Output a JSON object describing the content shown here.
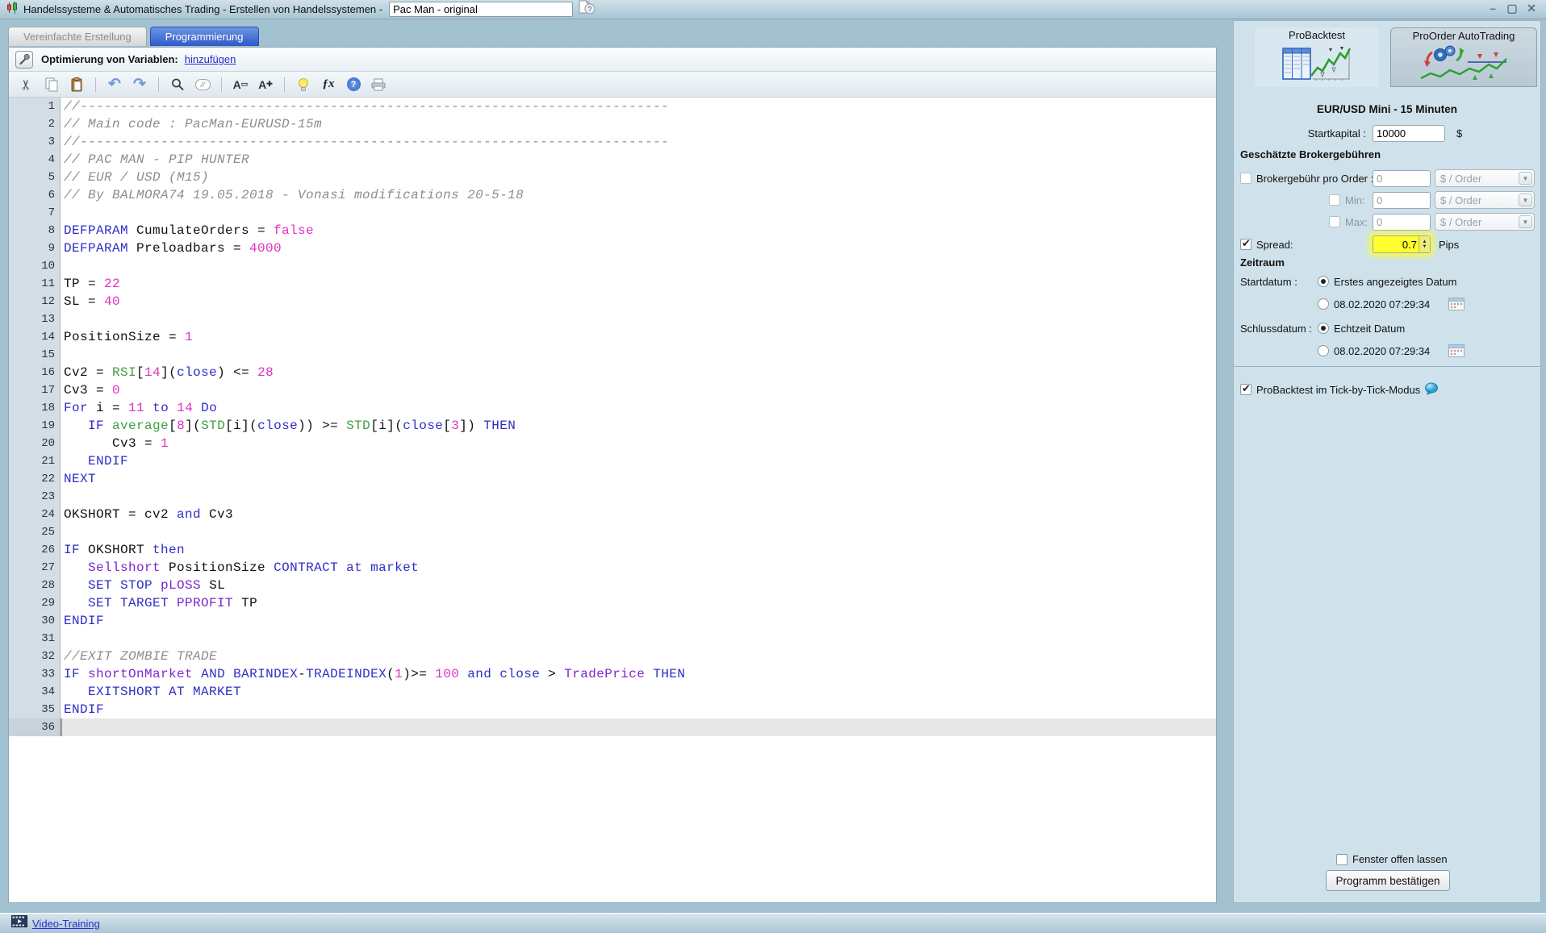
{
  "window": {
    "title": "Handelssysteme & Automatisches Trading - Erstellen von Handelssystemen  -",
    "name_value": "Pac Man - original",
    "controls": {
      "minimize": "–",
      "maximize": "▢",
      "close": "✕"
    }
  },
  "tabs": [
    {
      "label": "Vereinfachte Erstellung",
      "active": false
    },
    {
      "label": "Programmierung",
      "active": true
    }
  ],
  "optimization": {
    "label": "Optimierung von Variablen:",
    "link": "hinzufügen"
  },
  "toolbar": {
    "icons": [
      "cut",
      "copy",
      "paste",
      "undo",
      "redo",
      "search",
      "comment-toggle",
      "font-decrease",
      "font-increase",
      "hint",
      "insert-function",
      "help",
      "print"
    ]
  },
  "editor": {
    "current_line": 36,
    "lines": [
      {
        "tokens": [
          [
            "c",
            "//-------------------------------------------------------------------------"
          ]
        ]
      },
      {
        "tokens": [
          [
            "c",
            "// Main code : PacMan-EURUSD-15m"
          ]
        ]
      },
      {
        "tokens": [
          [
            "c",
            "//-------------------------------------------------------------------------"
          ]
        ]
      },
      {
        "tokens": [
          [
            "c",
            "// PAC MAN - PIP HUNTER"
          ]
        ]
      },
      {
        "tokens": [
          [
            "c",
            "// EUR / USD (M15)"
          ]
        ]
      },
      {
        "tokens": [
          [
            "c",
            "// By BALMORA74 19.05.2018 - Vonasi modifications 20-5-18"
          ]
        ]
      },
      {
        "tokens": []
      },
      {
        "tokens": [
          [
            "kw",
            "DEFPARAM"
          ],
          [
            "t",
            " CumulateOrders = "
          ],
          [
            "num",
            "false"
          ]
        ]
      },
      {
        "tokens": [
          [
            "kw",
            "DEFPARAM"
          ],
          [
            "t",
            " Preloadbars = "
          ],
          [
            "num",
            "4000"
          ]
        ]
      },
      {
        "tokens": []
      },
      {
        "tokens": [
          [
            "t",
            "TP = "
          ],
          [
            "num",
            "22"
          ]
        ]
      },
      {
        "tokens": [
          [
            "t",
            "SL = "
          ],
          [
            "num",
            "40"
          ]
        ]
      },
      {
        "tokens": []
      },
      {
        "tokens": [
          [
            "t",
            "PositionSize = "
          ],
          [
            "num",
            "1"
          ]
        ]
      },
      {
        "tokens": []
      },
      {
        "tokens": [
          [
            "t",
            "Cv2 = "
          ],
          [
            "fn",
            "RSI"
          ],
          [
            "t",
            "["
          ],
          [
            "num",
            "14"
          ],
          [
            "t",
            "]("
          ],
          [
            "kw",
            "close"
          ],
          [
            "t",
            ") <= "
          ],
          [
            "num",
            "28"
          ]
        ]
      },
      {
        "tokens": [
          [
            "t",
            "Cv3 = "
          ],
          [
            "num",
            "0"
          ]
        ]
      },
      {
        "tokens": [
          [
            "kw",
            "For"
          ],
          [
            "t",
            " i = "
          ],
          [
            "num",
            "11"
          ],
          [
            "t",
            " "
          ],
          [
            "kw",
            "to"
          ],
          [
            "t",
            " "
          ],
          [
            "num",
            "14"
          ],
          [
            "t",
            " "
          ],
          [
            "kw",
            "Do"
          ]
        ]
      },
      {
        "tokens": [
          [
            "t",
            "   "
          ],
          [
            "kw",
            "IF"
          ],
          [
            "t",
            " "
          ],
          [
            "fn",
            "average"
          ],
          [
            "t",
            "["
          ],
          [
            "num",
            "8"
          ],
          [
            "t",
            "]("
          ],
          [
            "fn",
            "STD"
          ],
          [
            "t",
            "[i]("
          ],
          [
            "kw",
            "close"
          ],
          [
            "t",
            ")) >= "
          ],
          [
            "fn",
            "STD"
          ],
          [
            "t",
            "[i]("
          ],
          [
            "kw",
            "close"
          ],
          [
            "t",
            "["
          ],
          [
            "num",
            "3"
          ],
          [
            "t",
            "]) "
          ],
          [
            "kw",
            "THEN"
          ]
        ]
      },
      {
        "tokens": [
          [
            "t",
            "      Cv3 = "
          ],
          [
            "num",
            "1"
          ]
        ]
      },
      {
        "tokens": [
          [
            "t",
            "   "
          ],
          [
            "kw",
            "ENDIF"
          ]
        ]
      },
      {
        "tokens": [
          [
            "kw",
            "NEXT"
          ]
        ]
      },
      {
        "tokens": []
      },
      {
        "tokens": [
          [
            "t",
            "OKSHORT = cv2 "
          ],
          [
            "kw",
            "and"
          ],
          [
            "t",
            " Cv3"
          ]
        ]
      },
      {
        "tokens": []
      },
      {
        "tokens": [
          [
            "kw",
            "IF"
          ],
          [
            "t",
            " OKSHORT "
          ],
          [
            "kw",
            "then"
          ]
        ]
      },
      {
        "tokens": [
          [
            "t",
            "   "
          ],
          [
            "pk",
            "Sellshort"
          ],
          [
            "t",
            " PositionSize "
          ],
          [
            "kw",
            "CONTRACT"
          ],
          [
            "t",
            " "
          ],
          [
            "kw",
            "at"
          ],
          [
            "t",
            " "
          ],
          [
            "kw",
            "market"
          ]
        ]
      },
      {
        "tokens": [
          [
            "t",
            "   "
          ],
          [
            "kw",
            "SET STOP"
          ],
          [
            "t",
            " "
          ],
          [
            "pk",
            "pLOSS"
          ],
          [
            "t",
            " SL"
          ]
        ]
      },
      {
        "tokens": [
          [
            "t",
            "   "
          ],
          [
            "kw",
            "SET TARGET"
          ],
          [
            "t",
            " "
          ],
          [
            "pk",
            "PPROFIT"
          ],
          [
            "t",
            " TP"
          ]
        ]
      },
      {
        "tokens": [
          [
            "kw",
            "ENDIF"
          ]
        ]
      },
      {
        "tokens": []
      },
      {
        "tokens": [
          [
            "c",
            "//EXIT ZOMBIE TRADE"
          ]
        ]
      },
      {
        "tokens": [
          [
            "kw",
            "IF"
          ],
          [
            "t",
            " "
          ],
          [
            "pk",
            "shortOnMarket"
          ],
          [
            "t",
            " "
          ],
          [
            "kw",
            "AND"
          ],
          [
            "t",
            " "
          ],
          [
            "kw",
            "BARINDEX"
          ],
          [
            "t",
            "-"
          ],
          [
            "kw",
            "TRADEINDEX"
          ],
          [
            "t",
            "("
          ],
          [
            "num",
            "1"
          ],
          [
            "t",
            ")>= "
          ],
          [
            "num",
            "100"
          ],
          [
            "t",
            " "
          ],
          [
            "kw",
            "and"
          ],
          [
            "t",
            " "
          ],
          [
            "kw",
            "close"
          ],
          [
            "t",
            " > "
          ],
          [
            "pk",
            "TradePrice"
          ],
          [
            "t",
            " "
          ],
          [
            "kw",
            "THEN"
          ]
        ]
      },
      {
        "tokens": [
          [
            "t",
            "   "
          ],
          [
            "kw",
            "EXITSHORT AT MARKET"
          ]
        ]
      },
      {
        "tokens": [
          [
            "kw",
            "ENDIF"
          ]
        ]
      },
      {
        "tokens": [],
        "current": true
      }
    ]
  },
  "sidebar": {
    "tabs": [
      {
        "label": "ProBacktest",
        "active": true
      },
      {
        "label": "ProOrder AutoTrading",
        "active": false
      }
    ],
    "instrument": "EUR/USD Mini - 15 Minuten",
    "startkapital": {
      "label": "Startkapital :",
      "value": "10000",
      "currency": "$"
    },
    "fees": {
      "heading": "Geschätzte Brokergebühren",
      "rows": [
        {
          "label": "Brokergebühr pro Order :",
          "checked": false,
          "value": "0",
          "unit": "$ / Order"
        },
        {
          "label": "Min:",
          "checked": false,
          "value": "0",
          "unit": "$ / Order"
        },
        {
          "label": "Max:",
          "checked": false,
          "value": "0",
          "unit": "$ / Order"
        }
      ],
      "spread": {
        "label": "Spread:",
        "checked": true,
        "value": "0.7",
        "unit": "Pips",
        "highlight_color": "#ffff00"
      }
    },
    "zeitraum": {
      "heading": "Zeitraum",
      "start_label": "Startdatum :",
      "start_options": [
        {
          "label": "Erstes angezeigtes Datum",
          "selected": true
        },
        {
          "label": "08.02.2020 07:29:34",
          "selected": false
        }
      ],
      "end_label": "Schlussdatum :",
      "end_options": [
        {
          "label": "Echtzeit Datum",
          "selected": true
        },
        {
          "label": "08.02.2020 07:29:34",
          "selected": false
        }
      ]
    },
    "tickmode": {
      "label": "ProBacktest im Tick-by-Tick-Modus",
      "checked": true
    },
    "keep_open": {
      "label": "Fenster offen lassen",
      "checked": false
    },
    "confirm_button": "Programm bestätigen"
  },
  "statusbar": {
    "link": "Video-Training"
  }
}
